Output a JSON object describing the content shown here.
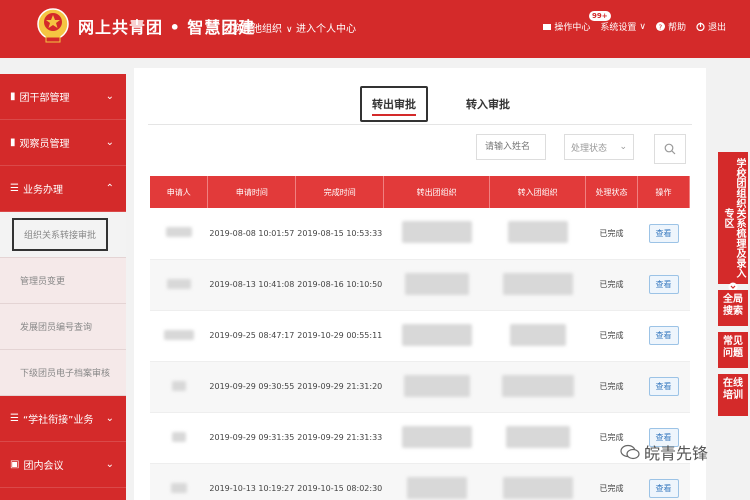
{
  "header": {
    "brand": "网上共青团 • 智慧团建",
    "nav_switch": "切换其他组织",
    "nav_center": "进入个人中心",
    "ops_center": "操作中心",
    "badge": "99+",
    "settings": "系统设置",
    "help": "帮助",
    "logout": "退出"
  },
  "sidebar": {
    "items": [
      {
        "label": "团干部管理"
      },
      {
        "label": "观察员管理"
      },
      {
        "label": "业务办理"
      }
    ],
    "subitems": [
      {
        "label": "组织关系转接审批"
      },
      {
        "label": "管理员变更"
      },
      {
        "label": "发展团员编号查询"
      },
      {
        "label": "下级团员电子档案审核"
      }
    ],
    "bottom_items": [
      {
        "label": "“学社衔接”业务"
      },
      {
        "label": "团内会议"
      }
    ]
  },
  "tabs": [
    {
      "label": "转出审批"
    },
    {
      "label": "转入审批"
    }
  ],
  "filters": {
    "search_placeholder": "请输入姓名",
    "status_label": "处理状态"
  },
  "table": {
    "headers": [
      "申请人",
      "申请时间",
      "完成时间",
      "转出团组织",
      "转入团组织",
      "处理状态",
      "操作"
    ],
    "rows": [
      {
        "apply": "2019-08-08 10:01:57",
        "done": "2019-08-15 10:53:33",
        "status": "已完成",
        "action": "查看"
      },
      {
        "apply": "2019-08-13 10:41:08",
        "done": "2019-08-16 10:10:50",
        "status": "已完成",
        "action": "查看"
      },
      {
        "apply": "2019-09-25 08:47:17",
        "done": "2019-10-29 00:55:11",
        "status": "已完成",
        "action": "查看"
      },
      {
        "apply": "2019-09-29 09:30:55",
        "done": "2019-09-29 21:31:20",
        "status": "已完成",
        "action": "查看"
      },
      {
        "apply": "2019-09-29 09:31:35",
        "done": "2019-09-29 21:31:33",
        "status": "已完成",
        "action": "查看"
      },
      {
        "apply": "2019-10-13 10:19:27",
        "done": "2019-10-15 08:02:30",
        "status": "已完成",
        "action": "查看"
      }
    ]
  },
  "rightbar": {
    "block1": "学校团组织关系梳理及录入专区",
    "block2": "全局搜索",
    "block3": "常见问题",
    "block4": "在线培训"
  },
  "watermark": "皖青先锋"
}
